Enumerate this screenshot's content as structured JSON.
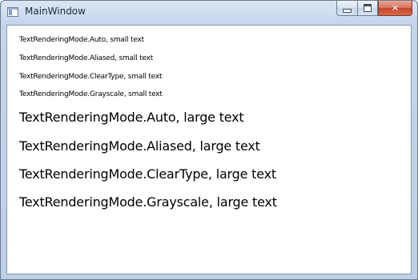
{
  "window": {
    "title": "MainWindow",
    "close_glyph": "✕"
  },
  "icons": {
    "app": "app-window-icon",
    "minimize": "minimize-icon",
    "maximize": "maximize-icon",
    "close": "close-icon"
  },
  "colors": {
    "titlebar": "#c4d5ea",
    "client_background": "#ffffff",
    "close_button": "#c8452a",
    "text": "#000000"
  },
  "content": {
    "lines": [
      "TextRenderingMode.Auto, small text",
      "TextRenderingMode.Aliased, small text",
      "TextRenderingMode.ClearType, small text",
      "TextRenderingMode.Grayscale, small text",
      "TextRenderingMode.Auto, large text",
      "TextRenderingMode.Aliased, large text",
      "TextRenderingMode.ClearType, large text",
      "TextRenderingMode.Grayscale, large text"
    ]
  }
}
